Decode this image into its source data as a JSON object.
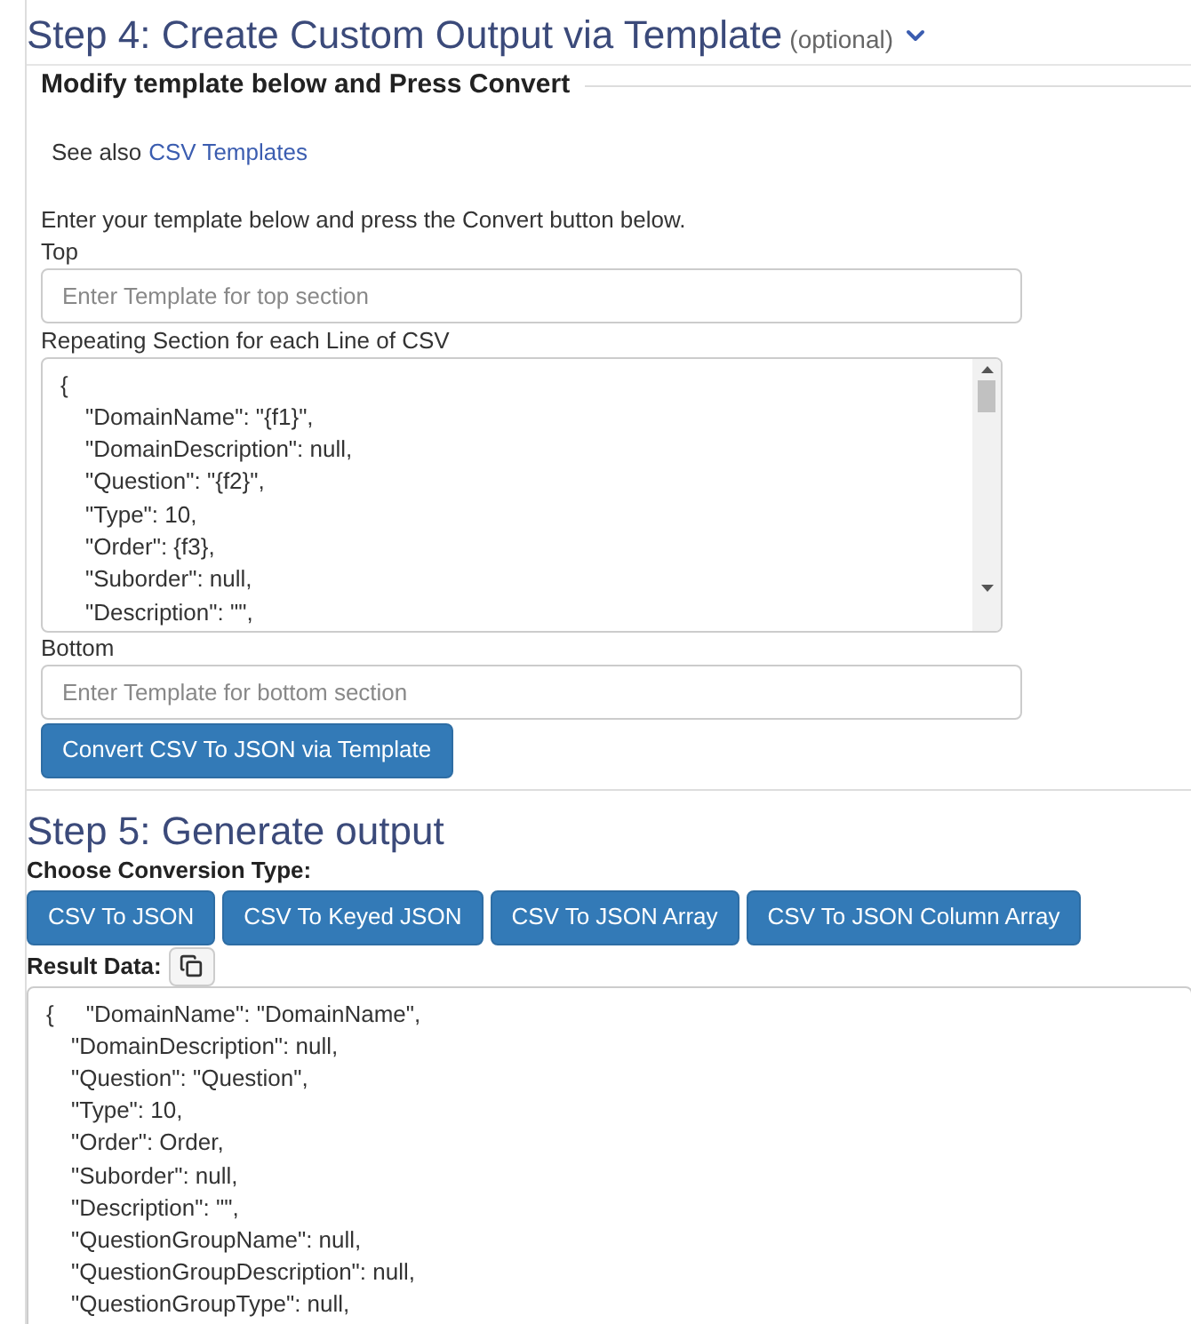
{
  "step4": {
    "title": "Step 4: Create Custom Output via Template",
    "optional": "(optional)",
    "expanded": true,
    "legend": "Modify template below and Press Convert",
    "see_also": "See also",
    "see_also_link": "CSV Templates",
    "instructions": "Enter your template below and press the Convert button below.",
    "top": {
      "label": "Top",
      "placeholder": "Enter Template for top section"
    },
    "repeating": {
      "label": "Repeating Section for each Line of CSV",
      "lines": [
        "{",
        "\"DomainName\": \"{f1}\",",
        "\"DomainDescription\": null,",
        "\"Question\": \"{f2}\",",
        "\"Type\": 10,",
        "\"Order\": {f3},",
        "\"Suborder\": null,",
        "\"Description\": \"\","
      ]
    },
    "bottom": {
      "label": "Bottom",
      "placeholder": "Enter Template for bottom section"
    },
    "convert_button": "Convert CSV To JSON via Template"
  },
  "step5": {
    "title": "Step 5: Generate output",
    "choose_label": "Choose Conversion Type:",
    "buttons": [
      "CSV To JSON",
      "CSV To Keyed JSON",
      "CSV To JSON Array",
      "CSV To JSON Column Array"
    ],
    "result_label": "Result Data:",
    "result_lines": [
      "{     \"DomainName\": \"DomainName\",",
      "\"DomainDescription\": null,",
      "\"Question\": \"Question\",",
      "\"Type\": 10,",
      "\"Order\": Order,",
      "\"Suborder\": null,",
      "\"Description\": \"\",",
      "\"QuestionGroupName\": null,",
      "\"QuestionGroupDescription\": null,",
      "\"QuestionGroupType\": null,"
    ]
  }
}
